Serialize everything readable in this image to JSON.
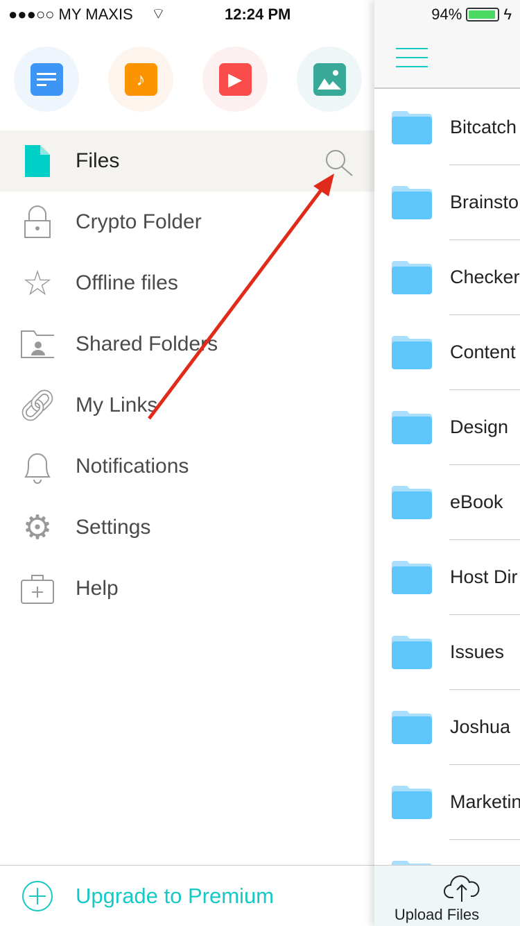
{
  "status": {
    "carrier": "●●●○○ MY MAXIS",
    "time": "12:24 PM",
    "battery": "94%",
    "battery_level": 0.94
  },
  "categories": [
    {
      "name": "documents",
      "bg": "#eef5fd",
      "color": "#3d96f5"
    },
    {
      "name": "music",
      "bg": "#fdf4ee",
      "color": "#fb9400"
    },
    {
      "name": "videos",
      "bg": "#fdf0f0",
      "color": "#fb4c4c"
    },
    {
      "name": "photos",
      "bg": "#eef6f7",
      "color": "#38a999"
    }
  ],
  "menu": [
    {
      "label": "Files"
    },
    {
      "label": "Crypto Folder"
    },
    {
      "label": "Offline files"
    },
    {
      "label": "Shared Folders"
    },
    {
      "label": "My Links"
    },
    {
      "label": "Notifications"
    },
    {
      "label": "Settings"
    },
    {
      "label": "Help"
    }
  ],
  "upgrade": {
    "label": "Upgrade to Premium",
    "color": "#16c9c5"
  },
  "folders": [
    {
      "name": "Bitcatch"
    },
    {
      "name": "Brainsto"
    },
    {
      "name": "Checker"
    },
    {
      "name": "Content"
    },
    {
      "name": "Design"
    },
    {
      "name": "eBook"
    },
    {
      "name": "Host Dir"
    },
    {
      "name": "Issues"
    },
    {
      "name": "Joshua"
    },
    {
      "name": "Marketin"
    }
  ],
  "upload": {
    "label": "Upload Files"
  },
  "annotation": {
    "arrow_color": "#e02a1a"
  }
}
